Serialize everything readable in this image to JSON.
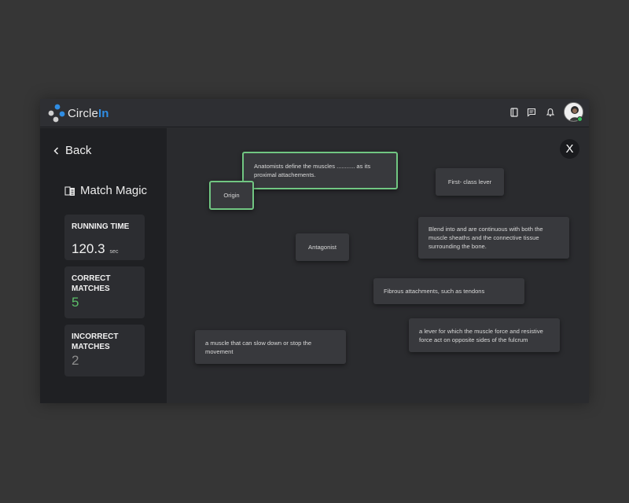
{
  "app": {
    "logo_main": "Circle",
    "logo_accent": "In"
  },
  "topbar_icons": [
    "notebook-icon",
    "chat-icon",
    "bell-icon"
  ],
  "sidebar": {
    "back_label": "Back",
    "game_title": "Match Magic",
    "stats": {
      "running_time_label": "RUNNING TIME",
      "running_time_value": "120.3",
      "running_time_unit": "sec",
      "correct_label": "CORRECT MATCHES",
      "correct_value": "5",
      "incorrect_label": "INCORRECT MATCHES",
      "incorrect_value": "2"
    }
  },
  "close_label": "X",
  "cards": {
    "definition_anatomists": "Anatomists define the muscles ........... as its proximal attachements.",
    "origin": "Origin",
    "first_class_lever": "First- class lever",
    "blend_into": "Blend into and are continuous with both the muscle sheaths and the connective tissue surrounding the bone.",
    "antagonist": "Antagonist",
    "fibrous": "Fibrous attachments, such as tendons",
    "lever_def": "a lever for which the muscle force and resistive force act on opposite sides of the fulcrum",
    "slow_down": "a muscle that can slow down or stop the movement"
  },
  "colors": {
    "accent_blue": "#2f8de4",
    "selected_green": "#71c682",
    "correct_green": "#5cbf69",
    "online_green": "#36c05a"
  }
}
